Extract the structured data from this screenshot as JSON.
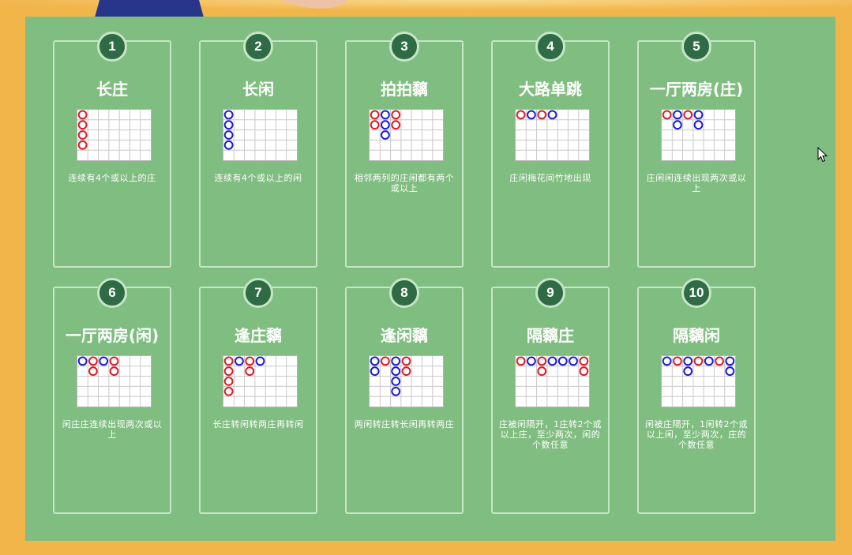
{
  "colors": {
    "banker": "#e01a23",
    "player": "#1a1ad6",
    "board": "#80bd80",
    "badge": "#2f6b45"
  },
  "patterns": [
    {
      "number": "1",
      "title": "长庄",
      "description": "连续有4个或以上的庄",
      "beads": [
        [
          0,
          0,
          "B"
        ],
        [
          0,
          1,
          "B"
        ],
        [
          0,
          2,
          "B"
        ],
        [
          0,
          3,
          "B"
        ]
      ]
    },
    {
      "number": "2",
      "title": "长闲",
      "description": "连续有4个或以上的闲",
      "beads": [
        [
          0,
          0,
          "P"
        ],
        [
          0,
          1,
          "P"
        ],
        [
          0,
          2,
          "P"
        ],
        [
          0,
          3,
          "P"
        ]
      ]
    },
    {
      "number": "3",
      "title": "拍拍黐",
      "description": "相邻两列的庄闲都有两个或以上",
      "beads": [
        [
          0,
          0,
          "B"
        ],
        [
          0,
          1,
          "B"
        ],
        [
          1,
          0,
          "P"
        ],
        [
          1,
          1,
          "P"
        ],
        [
          1,
          2,
          "P"
        ],
        [
          2,
          0,
          "B"
        ],
        [
          2,
          1,
          "B"
        ]
      ]
    },
    {
      "number": "4",
      "title": "大路单跳",
      "description": "庄闲梅花间竹地出现",
      "beads": [
        [
          0,
          0,
          "B"
        ],
        [
          1,
          0,
          "P"
        ],
        [
          2,
          0,
          "B"
        ],
        [
          3,
          0,
          "P"
        ]
      ]
    },
    {
      "number": "5",
      "title": "一厅两房(庄)",
      "description": "庄闲闲连续出现两次或以上",
      "beads": [
        [
          0,
          0,
          "B"
        ],
        [
          1,
          0,
          "P"
        ],
        [
          1,
          1,
          "P"
        ],
        [
          2,
          0,
          "B"
        ],
        [
          3,
          0,
          "P"
        ],
        [
          3,
          1,
          "P"
        ]
      ]
    },
    {
      "number": "6",
      "title": "一厅两房(闲)",
      "description": "闲庄庄连续出现两次或以上",
      "beads": [
        [
          0,
          0,
          "P"
        ],
        [
          1,
          0,
          "B"
        ],
        [
          1,
          1,
          "B"
        ],
        [
          2,
          0,
          "P"
        ],
        [
          3,
          0,
          "B"
        ],
        [
          3,
          1,
          "B"
        ]
      ]
    },
    {
      "number": "7",
      "title": "逢庄黐",
      "description": "长庄转闲转两庄再转闲",
      "beads": [
        [
          0,
          0,
          "B"
        ],
        [
          0,
          1,
          "B"
        ],
        [
          0,
          2,
          "B"
        ],
        [
          0,
          3,
          "B"
        ],
        [
          1,
          0,
          "P"
        ],
        [
          2,
          0,
          "B"
        ],
        [
          2,
          1,
          "B"
        ],
        [
          3,
          0,
          "P"
        ]
      ]
    },
    {
      "number": "8",
      "title": "逢闲黐",
      "description": "两闲转庄转长闲再转两庄",
      "beads": [
        [
          0,
          0,
          "P"
        ],
        [
          0,
          1,
          "P"
        ],
        [
          1,
          0,
          "B"
        ],
        [
          2,
          0,
          "P"
        ],
        [
          2,
          1,
          "P"
        ],
        [
          2,
          2,
          "P"
        ],
        [
          2,
          3,
          "P"
        ],
        [
          3,
          0,
          "B"
        ],
        [
          3,
          1,
          "B"
        ]
      ]
    },
    {
      "number": "9",
      "title": "隔黐庄",
      "description": "庄被闲隔开，1庄转2个或以上庄，至少两次，闲的个数任意",
      "beads": [
        [
          0,
          0,
          "B"
        ],
        [
          1,
          0,
          "P"
        ],
        [
          2,
          0,
          "B"
        ],
        [
          2,
          1,
          "B"
        ],
        [
          3,
          0,
          "P"
        ],
        [
          4,
          0,
          "P"
        ],
        [
          5,
          0,
          "P"
        ],
        [
          6,
          0,
          "B"
        ],
        [
          6,
          1,
          "B"
        ]
      ]
    },
    {
      "number": "10",
      "title": "隔黐闲",
      "description": "闲被庄隔开，1闲转2个或以上闲，至少两次，庄的个数任意",
      "beads": [
        [
          0,
          0,
          "P"
        ],
        [
          1,
          0,
          "B"
        ],
        [
          2,
          0,
          "P"
        ],
        [
          2,
          1,
          "P"
        ],
        [
          3,
          0,
          "B"
        ],
        [
          4,
          0,
          "P"
        ],
        [
          5,
          0,
          "B"
        ],
        [
          6,
          0,
          "P"
        ],
        [
          6,
          1,
          "P"
        ]
      ]
    }
  ]
}
